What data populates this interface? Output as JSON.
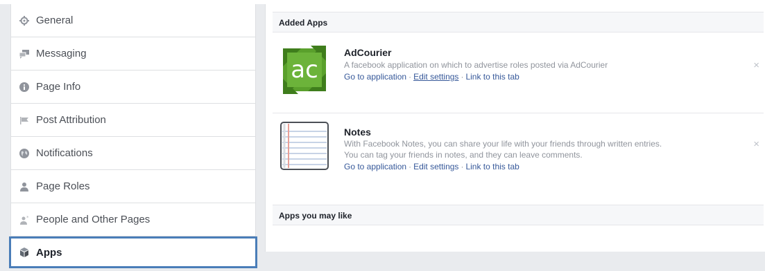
{
  "sidebar": {
    "items": [
      {
        "label": "General",
        "icon": "gear-icon"
      },
      {
        "label": "Messaging",
        "icon": "messaging-icon"
      },
      {
        "label": "Page Info",
        "icon": "info-icon"
      },
      {
        "label": "Post Attribution",
        "icon": "flag-icon"
      },
      {
        "label": "Notifications",
        "icon": "globe-icon"
      },
      {
        "label": "Page Roles",
        "icon": "person-icon"
      },
      {
        "label": "People and Other Pages",
        "icon": "person-star-icon"
      },
      {
        "label": "Apps",
        "icon": "cube-icon",
        "active": true
      }
    ]
  },
  "main": {
    "added_apps_header": "Added Apps",
    "apps": [
      {
        "title": "AdCourier",
        "description_lines": [
          "A facebook application on which to advertise roles posted via AdCourier"
        ],
        "links": [
          "Go to application",
          "Edit settings",
          "Link to this tab"
        ],
        "separator": "·",
        "close": "×",
        "logo_text": "ac"
      },
      {
        "title": "Notes",
        "description_lines": [
          "With Facebook Notes, you can share your life with your friends through written entries.",
          "You can tag your friends in notes, and they can leave comments."
        ],
        "links": [
          "Go to application",
          "Edit settings",
          "Link to this tab"
        ],
        "separator": "·",
        "close": "×"
      }
    ],
    "apps_you_may_like_header": "Apps you may like"
  },
  "colors": {
    "link": "#365899",
    "active_outline": "#4a7db8",
    "adcourier_green": "#5aa02c"
  }
}
